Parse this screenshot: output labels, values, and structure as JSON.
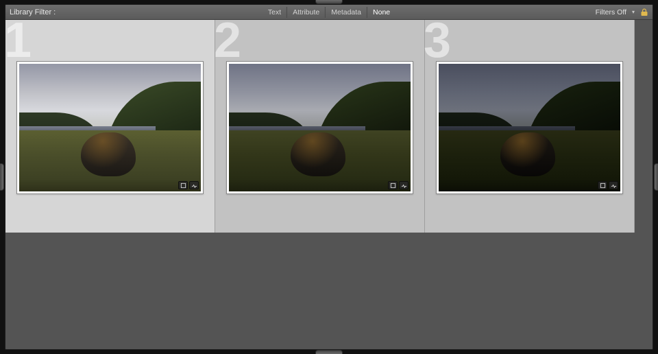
{
  "filter_bar": {
    "label": "Library Filter :",
    "tabs": [
      "Text",
      "Attribute",
      "Metadata",
      "None"
    ],
    "active_tab": "None",
    "filters_off_label": "Filters Off",
    "lock_icon": "lock-icon"
  },
  "grid": {
    "cells": [
      {
        "index": "1",
        "selected": true,
        "variant": "v1",
        "badges": [
          "crop-badge-icon",
          "develop-badge-icon"
        ]
      },
      {
        "index": "2",
        "selected": false,
        "variant": "v2",
        "badges": [
          "crop-badge-icon",
          "develop-badge-icon"
        ]
      },
      {
        "index": "3",
        "selected": false,
        "variant": "v3",
        "badges": [
          "crop-badge-icon",
          "develop-badge-icon"
        ]
      }
    ]
  }
}
